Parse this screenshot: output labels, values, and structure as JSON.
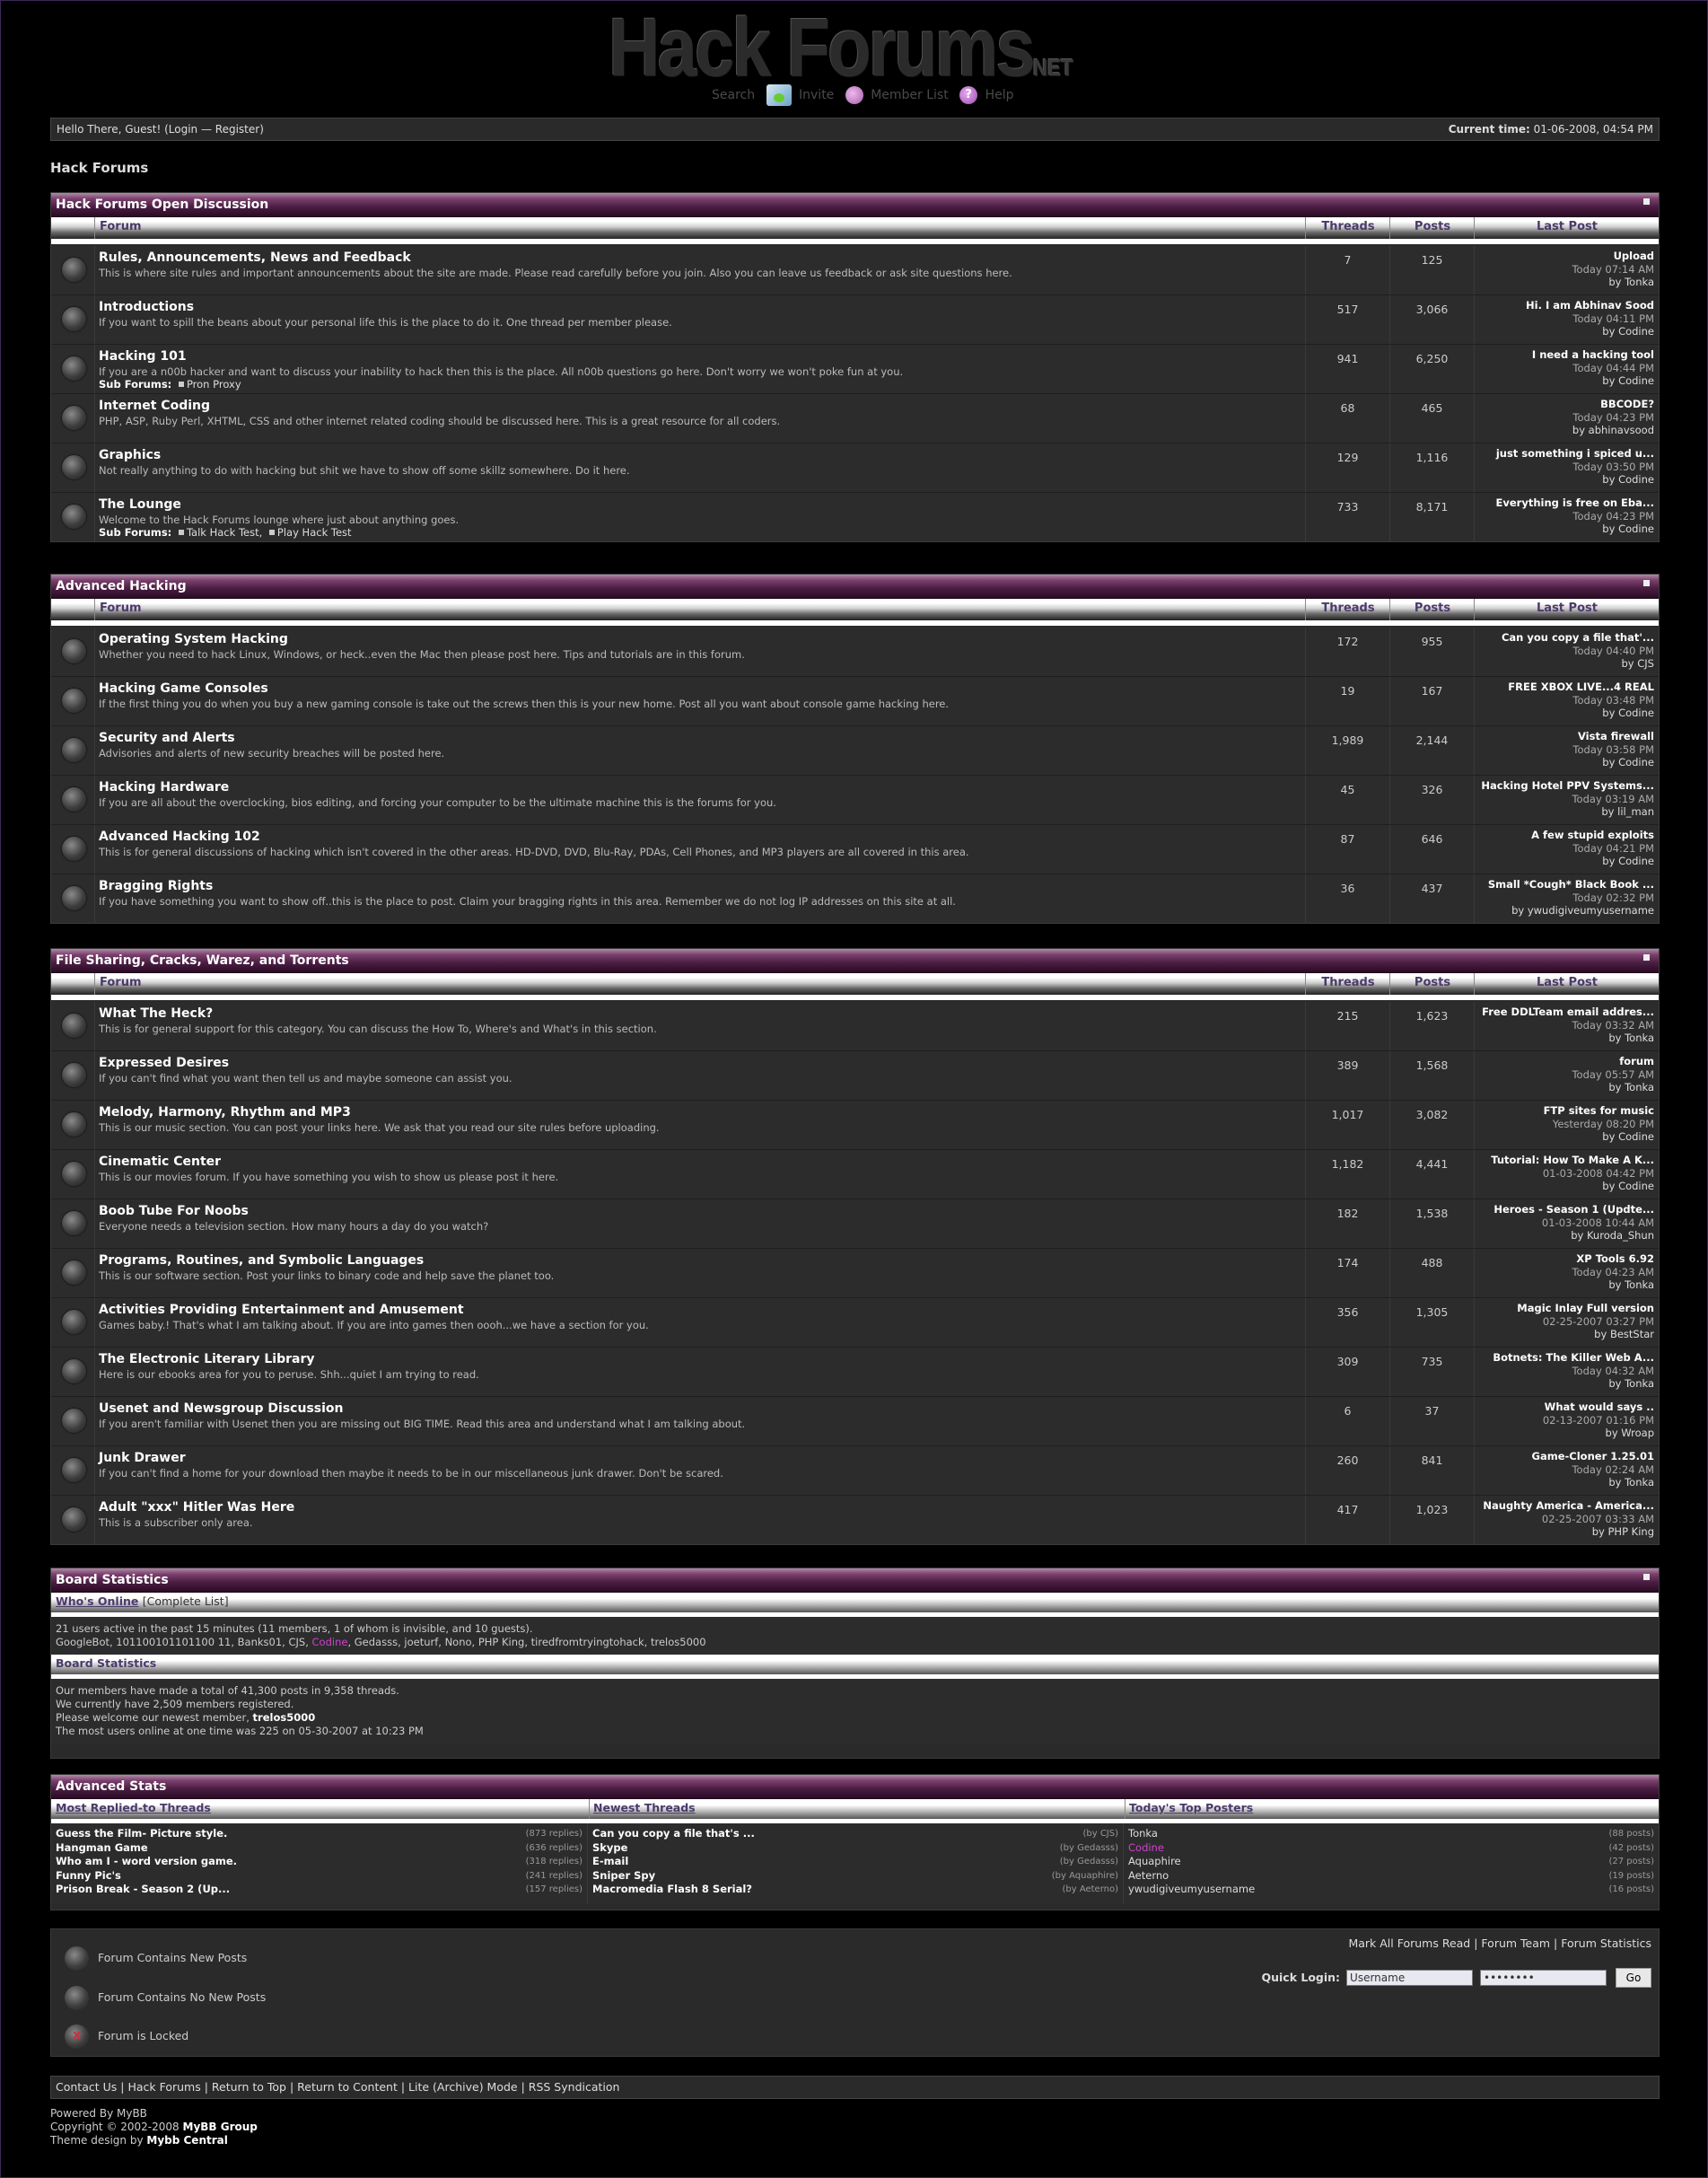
{
  "header": {
    "logo_main": "Hack Forums",
    "logo_suffix": "NET",
    "menu": {
      "search": "Search",
      "invite": "Invite",
      "members": "Member List",
      "help": "Help"
    }
  },
  "welcome": {
    "greeting": "Hello There, Guest! (",
    "login": "Login",
    "sep": " — ",
    "register": "Register",
    "close": ")",
    "time_label": "Current time:",
    "time_value": "01-06-2008, 04:54 PM"
  },
  "breadcrumb": "Hack Forums",
  "headers": {
    "forum": "Forum",
    "threads": "Threads",
    "posts": "Posts",
    "last_post": "Last Post"
  },
  "categories": [
    {
      "title": "Hack Forums Open Discussion",
      "forums": [
        {
          "name": "Rules, Announcements, News and Feedback",
          "desc": "This is where site rules and important announcements about the site are made. Please read carefully before you join. Also you can leave us feedback or ask site questions here.",
          "threads": "7",
          "posts": "125",
          "last_title": "Upload",
          "last_date": "Today 07:14 AM",
          "last_by": "Tonka"
        },
        {
          "name": "Introductions",
          "desc": "If you want to spill the beans about your personal life this is the place to do it. One thread per member please.",
          "threads": "517",
          "posts": "3,066",
          "last_title": "Hi. I am Abhinav Sood",
          "last_date": "Today 04:11 PM",
          "last_by": "Codine"
        },
        {
          "name": "Hacking 101",
          "desc": "If you are a n00b hacker and want to discuss your inability to hack then this is the place. All n00b questions go here. Don't worry we won't poke fun at you.",
          "subforums_label": "Sub Forums:",
          "subforums": [
            "Pron Proxy"
          ],
          "threads": "941",
          "posts": "6,250",
          "last_title": "I need a hacking tool",
          "last_date": "Today 04:44 PM",
          "last_by": "Codine"
        },
        {
          "name": "Internet Coding",
          "desc": "PHP, ASP, Ruby Perl, XHTML, CSS and other internet related coding should be discussed here.  This is a great resource for all coders.",
          "threads": "68",
          "posts": "465",
          "last_title": "BBCODE?",
          "last_date": "Today 04:23 PM",
          "last_by": "abhinavsood"
        },
        {
          "name": "Graphics",
          "desc": "Not really anything to do with hacking but shit we have to show off some skillz somewhere. Do it here.",
          "threads": "129",
          "posts": "1,116",
          "last_title": "just something i spiced u...",
          "last_date": "Today 03:50 PM",
          "last_by": "Codine"
        },
        {
          "name": "The Lounge",
          "desc": "Welcome to the Hack Forums lounge where just about anything goes.",
          "subforums_label": "Sub Forums:",
          "subforums": [
            "Talk Hack Test,",
            "Play Hack Test"
          ],
          "threads": "733",
          "posts": "8,171",
          "last_title": "Everything is free on Eba...",
          "last_date": "Today 04:23 PM",
          "last_by": "Codine"
        }
      ]
    },
    {
      "title": "Advanced Hacking",
      "forums": [
        {
          "name": "Operating System Hacking",
          "desc": "Whether you need to hack Linux, Windows, or heck..even the Mac then please post here. Tips and tutorials are in this forum.",
          "threads": "172",
          "posts": "955",
          "last_title": "Can you copy a file that'...",
          "last_date": "Today 04:40 PM",
          "last_by": "CJS"
        },
        {
          "name": "Hacking Game Consoles",
          "desc": "If the first thing you do when you buy a new gaming console is take out the screws then this is your new home. Post all you want about console game hacking here.",
          "threads": "19",
          "posts": "167",
          "last_title": "FREE XBOX LIVE...4 REAL",
          "last_date": "Today 03:48 PM",
          "last_by": "Codine"
        },
        {
          "name": "Security and Alerts",
          "desc": "Advisories and alerts of new security breaches will be posted here.",
          "threads": "1,989",
          "posts": "2,144",
          "last_title": "Vista firewall",
          "last_date": "Today 03:58 PM",
          "last_by": "Codine"
        },
        {
          "name": "Hacking Hardware",
          "desc": "If you are all about the overclocking, bios editing, and forcing your computer to be the ultimate machine this is the forums for you.",
          "threads": "45",
          "posts": "326",
          "last_title": "Hacking Hotel PPV Systems...",
          "last_date": "Today 03:19 AM",
          "last_by": "lil_man"
        },
        {
          "name": "Advanced Hacking 102",
          "desc": "This is for general discussions of hacking which isn't covered in the other areas.  HD-DVD, DVD, Blu-Ray, PDAs, Cell Phones, and MP3 players are all covered in this area.",
          "threads": "87",
          "posts": "646",
          "last_title": "A few stupid exploits",
          "last_date": "Today 04:21 PM",
          "last_by": "Codine"
        },
        {
          "name": "Bragging Rights",
          "desc": "If you have something you want to show off..this is the place to post. Claim your bragging rights in this area. Remember we do not log IP addresses on this site at all.",
          "threads": "36",
          "posts": "437",
          "last_title": "Small *Cough* Black Book ...",
          "last_date": "Today 02:32 PM",
          "last_by": "ywudigiveumyusername"
        }
      ]
    },
    {
      "title": "File Sharing, Cracks, Warez, and Torrents",
      "forums": [
        {
          "name": "What The Heck?",
          "desc": "This is for general support for this category. You can discuss the How To, Where's and What's in this section.",
          "threads": "215",
          "posts": "1,623",
          "last_title": "Free DDLTeam email addres...",
          "last_date": "Today 03:32 AM",
          "last_by": "Tonka"
        },
        {
          "name": "Expressed Desires",
          "desc": "If you can't find what you want then tell us and maybe someone can assist you.",
          "threads": "389",
          "posts": "1,568",
          "last_title": "forum",
          "last_date": "Today 05:57 AM",
          "last_by": "Tonka"
        },
        {
          "name": "Melody, Harmony, Rhythm and MP3",
          "desc": "This is our music section. You can post your links here. We ask that you read our site rules before uploading.",
          "threads": "1,017",
          "posts": "3,082",
          "last_title": "FTP sites for music",
          "last_date": "Yesterday 08:20 PM",
          "last_by": "Codine"
        },
        {
          "name": "Cinematic Center",
          "desc": "This is our movies forum. If you have something you wish to show us please post it here.",
          "threads": "1,182",
          "posts": "4,441",
          "last_title": "Tutorial: How To Make A K...",
          "last_date": "01-03-2008 04:42 PM",
          "last_by": "Codine"
        },
        {
          "name": "Boob Tube For Noobs",
          "desc": "Everyone needs a television section. How many hours a day do you watch?",
          "threads": "182",
          "posts": "1,538",
          "last_title": "Heroes - Season 1 (Updte...",
          "last_date": "01-03-2008 10:44 AM",
          "last_by": "Kuroda_Shun"
        },
        {
          "name": "Programs, Routines, and Symbolic Languages",
          "desc": "This is our software section. Post your links to binary code and help save the planet too.",
          "threads": "174",
          "posts": "488",
          "last_title": "XP Tools 6.92",
          "last_date": "Today 04:23 AM",
          "last_by": "Tonka"
        },
        {
          "name": "Activities Providing Entertainment and Amusement",
          "desc": "Games baby.! That's what I am talking about. If you are into games then oooh...we have a section for you.",
          "threads": "356",
          "posts": "1,305",
          "last_title": "Magic Inlay Full version",
          "last_date": "02-25-2007 03:27 PM",
          "last_by": "BestStar"
        },
        {
          "name": "The Electronic Literary Library",
          "desc": "Here is our ebooks area for you to peruse. Shh...quiet I am trying to read.",
          "threads": "309",
          "posts": "735",
          "last_title": "Botnets: The Killer Web A...",
          "last_date": "Today 04:32 AM",
          "last_by": "Tonka"
        },
        {
          "name": "Usenet and Newsgroup Discussion",
          "desc": "If you aren't familiar with Usenet then you are missing out BIG TIME. Read this area and understand what I am talking about.",
          "threads": "6",
          "posts": "37",
          "last_title": "What would says ..",
          "last_date": "02-13-2007 01:16 PM",
          "last_by": "Wroap"
        },
        {
          "name": "Junk Drawer",
          "desc": "If you can't find a home for your download then maybe it needs to be in our miscellaneous junk drawer. Don't be scared.",
          "threads": "260",
          "posts": "841",
          "last_title": "Game-Cloner 1.25.01",
          "last_date": "Today 02:24 AM",
          "last_by": "Tonka"
        },
        {
          "name": "Adult \"xxx\" Hitler Was Here",
          "desc": "This is a subscriber only area.",
          "threads": "417",
          "posts": "1,023",
          "last_title": "Naughty America - America...",
          "last_date": "02-25-2007 03:33 AM",
          "last_by": "PHP King"
        }
      ]
    }
  ],
  "by_label": "by",
  "board_stats": {
    "title": "Board Statistics",
    "whos_online": "Who's Online",
    "complete_list": "Complete List",
    "online_line1": "21 users active in the past 15 minutes (11 members, 1 of whom is invisible, and 10 guests).",
    "online_users_pre": "GoogleBot, 101100101101100 11, Banks01, CJS, ",
    "online_users_hl": "Codine",
    "online_users_post": ", Gedasss, joeturf, Nono, PHP King, tiredfromtryingtohack, trelos5000",
    "stats_sub": "Board Statistics",
    "line1": "Our members have made a total of 41,300 posts in 9,358 threads.",
    "line2": "We currently have 2,509 members registered.",
    "line3_pre": "Please welcome our newest member, ",
    "line3_name": "trelos5000",
    "line4": "The most users online at one time was 225 on 05-30-2007 at 10:23 PM"
  },
  "advanced_stats": {
    "title": "Advanced Stats",
    "col1": "Most Replied-to Threads",
    "col2": "Newest Threads",
    "col3": "Today's Top Posters",
    "replied": [
      {
        "t": "Guess the Film- Picture style.",
        "n": "(873 replies)"
      },
      {
        "t": "Hangman Game",
        "n": "(636 replies)"
      },
      {
        "t": "Who am I - word version game.",
        "n": "(318 replies)"
      },
      {
        "t": "Funny Pic's",
        "n": "(241 replies)"
      },
      {
        "t": "Prison Break - Season 2 (Up...",
        "n": "(157 replies)"
      }
    ],
    "newest": [
      {
        "t": "Can you copy a file that's ...",
        "n": "(by CJS)"
      },
      {
        "t": "Skype",
        "n": "(by Gedasss)"
      },
      {
        "t": "E-mail",
        "n": "(by Gedasss)"
      },
      {
        "t": "Sniper Spy",
        "n": "(by Aquaphire)"
      },
      {
        "t": "Macromedia Flash 8 Serial?",
        "n": "(by Aeterno)"
      }
    ],
    "posters": [
      {
        "t": "Tonka",
        "n": "(88 posts)"
      },
      {
        "t": "Codine",
        "n": "(42 posts)"
      },
      {
        "t": "Aquaphire",
        "n": "(27 posts)"
      },
      {
        "t": "Aeterno",
        "n": "(19 posts)"
      },
      {
        "t": "ywudigiveumyusername",
        "n": "(16 posts)"
      }
    ]
  },
  "legend": {
    "new": "Forum Contains New Posts",
    "nonew": "Forum Contains No New Posts",
    "locked": "Forum is Locked"
  },
  "links": {
    "mark_read": "Mark All Forums Read",
    "team": "Forum Team",
    "stats": "Forum Statistics"
  },
  "quick_login": {
    "label": "Quick Login:",
    "username": "Username",
    "password": "••••••••",
    "go": "Go"
  },
  "bottom": {
    "contact": "Contact Us",
    "home": "Hack Forums",
    "top": "Return to Top",
    "content": "Return to Content",
    "lite": "Lite (Archive) Mode",
    "rss": "RSS Syndication"
  },
  "footer": {
    "powered_pre": "Powered By ",
    "powered": "MyBB",
    "copy_pre": "Copyright © 2002-2008 ",
    "copy": "MyBB Group",
    "theme_pre": "Theme design by ",
    "theme": "Mybb Central"
  }
}
